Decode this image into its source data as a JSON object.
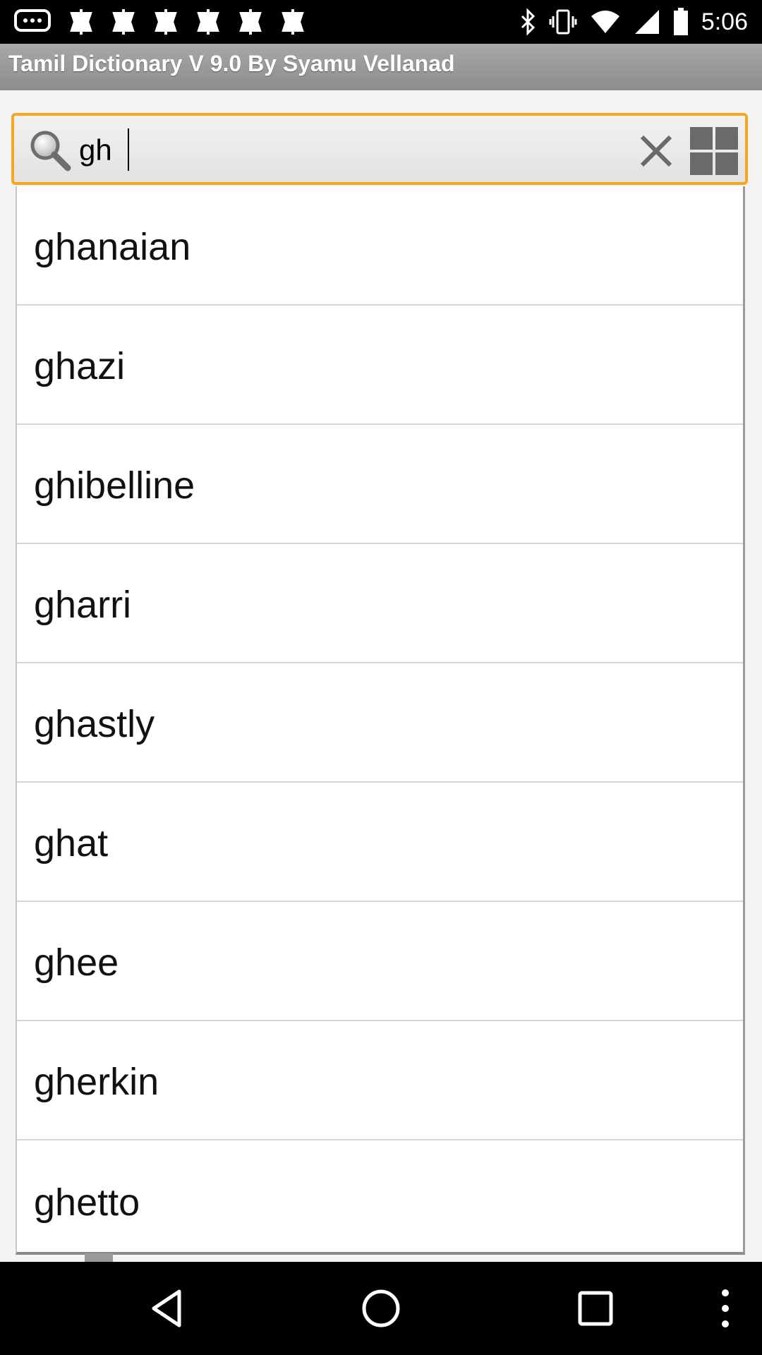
{
  "status_bar": {
    "time": "5:06",
    "left_icons": [
      "chat-icon",
      "notification-icon",
      "notification-icon",
      "notification-icon",
      "notification-icon",
      "notification-icon",
      "notification-icon"
    ],
    "right_icons": [
      "bluetooth-icon",
      "vibrate-icon",
      "wifi-icon",
      "signal-icon",
      "battery-icon"
    ]
  },
  "app": {
    "title": "Tamil Dictionary V 9.0 By Syamu Vellanad"
  },
  "search": {
    "value": "gh",
    "accent_color": "#f5a623"
  },
  "suggestions": [
    {
      "label": "ghanaian"
    },
    {
      "label": "ghazi"
    },
    {
      "label": "ghibelline"
    },
    {
      "label": "gharri"
    },
    {
      "label": "ghastly"
    },
    {
      "label": "ghat"
    },
    {
      "label": "ghee"
    },
    {
      "label": "gherkin"
    },
    {
      "label": "ghetto"
    }
  ],
  "nav_bar": {
    "buttons": [
      "back-icon",
      "home-icon",
      "recent-apps-icon",
      "menu-icon"
    ]
  }
}
